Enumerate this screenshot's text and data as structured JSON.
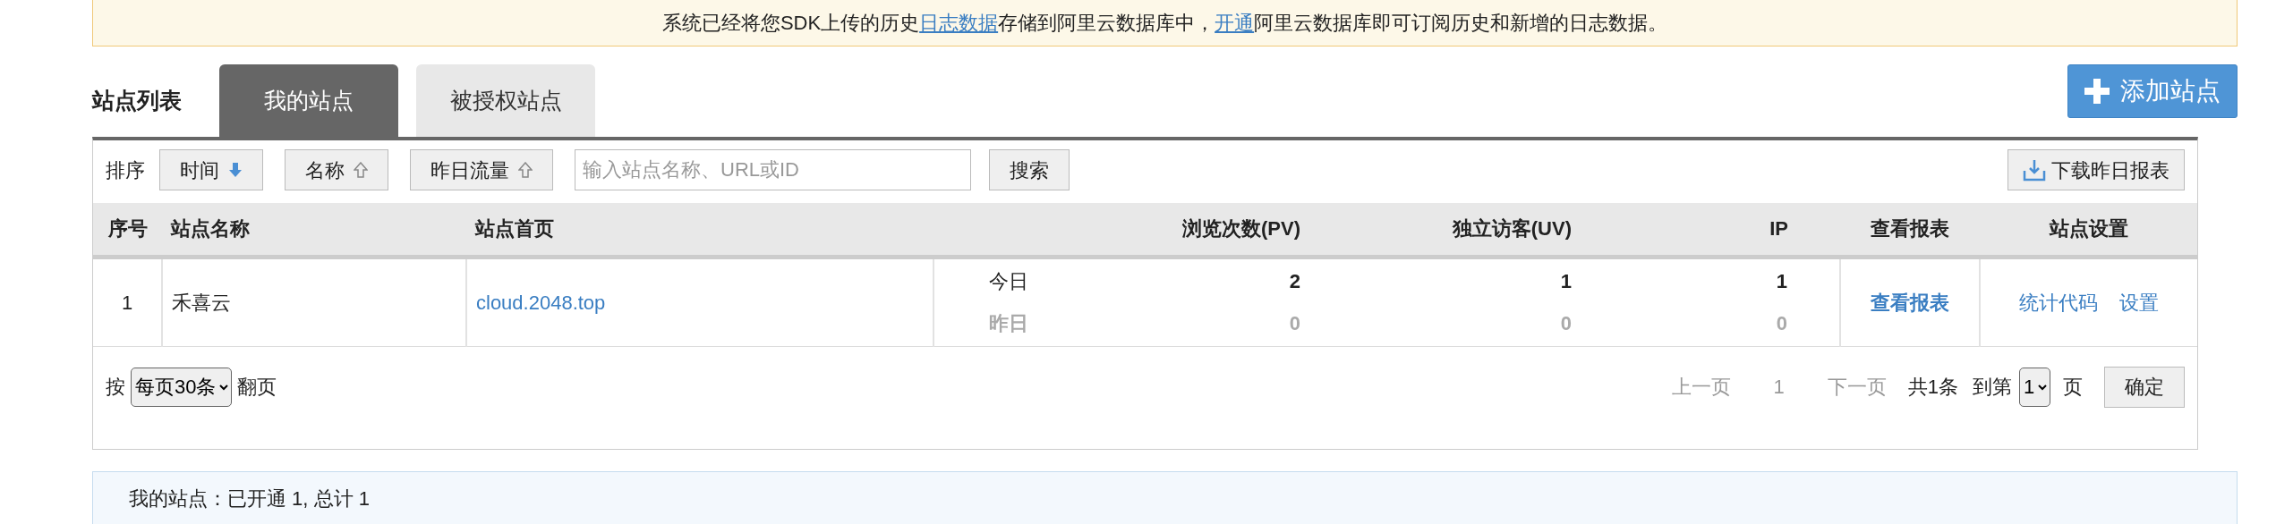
{
  "banner": {
    "segments": [
      {
        "text": "系统已经将您SDK上传的历史",
        "link": false
      },
      {
        "text": "日志数据",
        "link": true
      },
      {
        "text": "存储到阿里云数据库中，",
        "link": false
      },
      {
        "text": "开通",
        "link": true
      },
      {
        "text": "阿里云数据库即可订阅历史和新增的日志数据。",
        "link": false
      }
    ]
  },
  "heading": "站点列表",
  "tabs": [
    {
      "label": "我的站点",
      "selected": true
    },
    {
      "label": "被授权站点",
      "selected": false
    }
  ],
  "add_button": "添加站点",
  "toolbar": {
    "sort_label": "排序",
    "sort_buttons": [
      {
        "label": "时间",
        "kind": "down",
        "selected": true
      },
      {
        "label": "名称",
        "kind": "up",
        "selected": false
      },
      {
        "label": "昨日流量",
        "kind": "up",
        "selected": false
      }
    ],
    "search": {
      "placeholder": "输入站点名称、URL或ID"
    },
    "search_button": "搜索",
    "download_button": "下载昨日报表"
  },
  "table": {
    "columns": [
      "序号",
      "站点名称",
      "站点首页",
      "",
      "浏览次数(PV)",
      "独立访客(UV)",
      "IP",
      "查看报表",
      "站点设置"
    ],
    "rows": [
      {
        "index": "1",
        "name": "禾喜云",
        "homepage": "cloud.2048.top",
        "periods": [
          {
            "label": "今日",
            "pv": "2",
            "uv": "1",
            "ip": "1",
            "dimmed": false
          },
          {
            "label": "昨日",
            "pv": "0",
            "uv": "0",
            "ip": "0",
            "dimmed": true
          }
        ],
        "report_link": "查看报表",
        "settings_links": [
          "统计代码",
          "设置"
        ]
      }
    ]
  },
  "pager": {
    "prefix": "按",
    "page_size": "每页30条",
    "suffix": "翻页",
    "prev": "上一页",
    "prev_disabled": true,
    "current_page": "1",
    "next": "下一页",
    "next_disabled": true,
    "total": "共1条",
    "goto": "到第",
    "goto_page": "1",
    "page_unit": "页",
    "confirm": "确定"
  },
  "summary": "我的站点：已开通 1, 总计 1"
}
